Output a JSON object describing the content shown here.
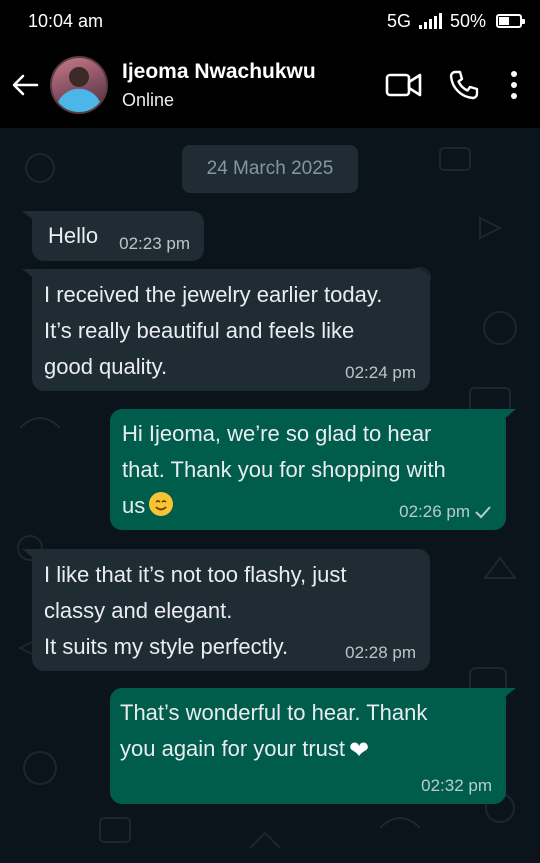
{
  "status_bar": {
    "time": "10:04 am",
    "network": "5G",
    "battery": "50%",
    "battery_level": 0.5
  },
  "header": {
    "contact_name": "Ijeoma Nwachukwu",
    "contact_status": "Online",
    "icons": [
      "back-arrow-icon",
      "video-call-icon",
      "phone-call-icon",
      "more-options-icon"
    ]
  },
  "chat": {
    "date_label": "24 March 2025",
    "messages": [
      {
        "direction": "incoming",
        "text": "Hello",
        "time": "02:23 pm"
      },
      {
        "direction": "incoming",
        "text": "I received the jewelry earlier today.\nIt’s really beautiful and feels like\ngood quality.",
        "time": "02:24 pm"
      },
      {
        "direction": "outgoing",
        "text": "Hi Ijeoma, we’re so glad to hear\nthat. Thank you for shopping with\nus",
        "emoji": "smiling-face-emoji",
        "time": "02:26 pm",
        "status_icon": "single-check-icon"
      },
      {
        "direction": "incoming",
        "text": "I like that it’s not too flashy, just\nclassy and elegant.\nIt suits my style perfectly.",
        "time": "02:28 pm"
      },
      {
        "direction": "outgoing",
        "text": "That’s wonderful to hear. Thank\nyou again for your trust",
        "emoji": "white-heart-emoji",
        "time": "02:32 pm"
      }
    ]
  },
  "colors": {
    "chat_background": "#0b141a",
    "incoming_bubble": "#202c33",
    "outgoing_bubble": "#005c4b",
    "header_background": "#000000"
  }
}
